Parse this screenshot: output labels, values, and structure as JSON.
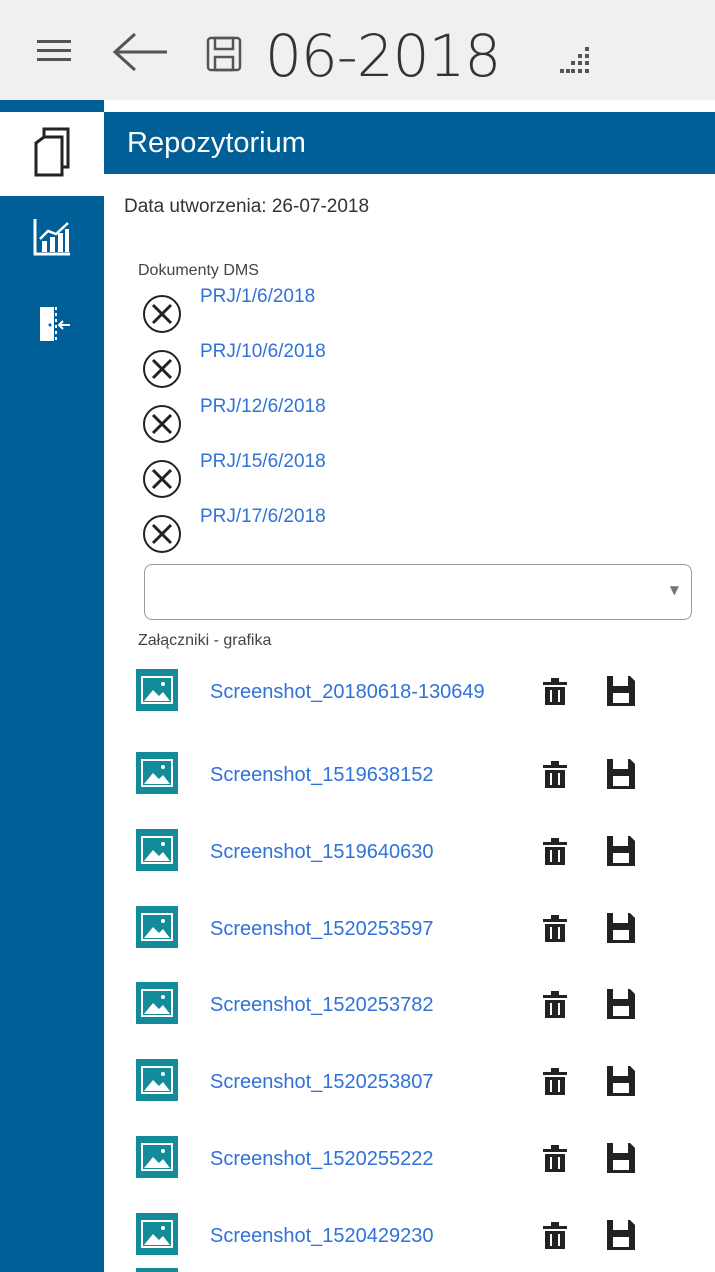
{
  "toolbar": {
    "title": "06-2018",
    "icons": [
      "hamburger-icon",
      "back-arrow-icon",
      "save-icon",
      "grid-dots-icon"
    ]
  },
  "rail": {
    "items": [
      "documents-icon",
      "chart-icon",
      "exit-door-icon"
    ]
  },
  "panel": {
    "title": "Repozytorium",
    "created": "Data utworzenia: 26-07-2018",
    "dms_label": "Dokumenty DMS",
    "dms_items": [
      "PRJ/1/6/2018",
      "PRJ/10/6/2018",
      "PRJ/12/6/2018",
      "PRJ/15/6/2018",
      "PRJ/17/6/2018"
    ],
    "dms_select_value": "",
    "attachments_label": "Załączniki - grafika",
    "attachments": [
      "Screenshot_20180618-130649",
      "Screenshot_1519638152",
      "Screenshot_1519640630",
      "Screenshot_1520253597",
      "Screenshot_1520253782",
      "Screenshot_1520253807",
      "Screenshot_1520255222",
      "Screenshot_1520429230",
      ""
    ]
  },
  "colors": {
    "accent": "#005f96",
    "link": "#2f72d9",
    "thumb": "#138b98",
    "toolbar_bg": "#f0f0f0"
  }
}
